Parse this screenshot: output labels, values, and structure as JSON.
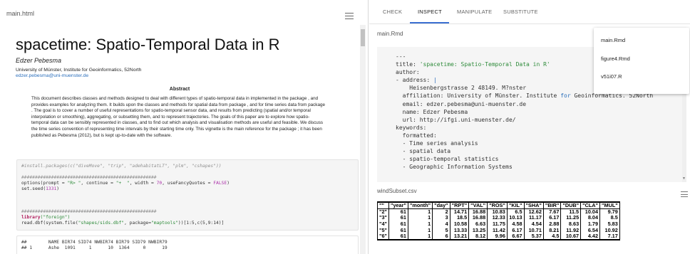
{
  "left": {
    "filename": "main.html",
    "doc": {
      "title": "spacetime: Spatio-Temporal Data in R",
      "author": "Edzer Pebesma",
      "affiliation": "University of Münster, Institute for Geoinformatics, 52North",
      "email": "edzer.pebesma@uni-muenster.de",
      "abstract_heading": "Abstract",
      "abstract_text": "This document describes classes and methods designed to deal with different types of spatio-temporal data in implemented in the package , and provides examples for analyzing them. It builds upon the classes and methods for spatial data from package , and for time series data from package . The goal is to cover a number of useful representations for spatio-temporal sensor data, and results from predicting (spatial and/or temporal interpolation or smoothing), aggregating, or subsetting them, and to represent trajectories. The goals of this paper are to explore how spatio-temporal data can be sensibly represented in classes, and to find out which analysis and visualisation methods are useful and feasible. We discuss the time series convention of representing time intervals by their starting time only. This vignette is the main reference for the package ; it has been published as Pebesma (2012), but is kept up-to-date with the software."
    },
    "code1": {
      "comment1": "#install.packages(c(\"diveMove\", \"trip\", \"adehabitatLT\", \"plm\", \"cshapes\"))",
      "hashes": "##################################################",
      "opt_pre": "options(prompt = ",
      "opt_prompt": "\"R> \"",
      "opt_mid1": ", continue = ",
      "opt_cont": "\"+  \"",
      "opt_mid2": ", width = ",
      "opt_width": "70",
      "opt_mid3": ", useFancyQuotes = ",
      "opt_false": "FALSE",
      "opt_end": ")",
      "seed_pre": "set.seed(",
      "seed_num": "1331",
      "seed_end": ")",
      "lib_kw": "library",
      "lib_arg": "(\"foreign\")",
      "read_pre": "read.dbf(system.file(",
      "read_str1": "\"shapes/sids.dbf\"",
      "read_mid": ", package=",
      "read_str2": "\"maptools\"",
      "read_post": "))[1:5,c(5,9:14)]"
    },
    "code2": {
      "line1": "##        NAME BIR74 SID74 NWBIR74 BIR79 SID79 NWBIR79",
      "line2": "## 1      Ashe  1091     1      10  1364     0      19"
    }
  },
  "right": {
    "tabs": [
      {
        "label": "CHECK"
      },
      {
        "label": "INSPECT"
      },
      {
        "label": "MANIPULATE"
      },
      {
        "label": "SUBSTITUTE"
      }
    ],
    "rmd_filename": "main.Rmd",
    "rmd_lines": {
      "l1": "---",
      "l2_key": "title: ",
      "l2_val": "'spacetime: Spatio-Temporal Data in R'",
      "l3": "author:",
      "l4_key": "- address: ",
      "l4_val": "|",
      "l5": "    Heisenbergstrasse 2 48149. M?nster",
      "l6_pre": "  affiliation: University of Münster. Institute ",
      "l6_for": "for",
      "l6_post": " Geoinformatics. 52North",
      "l7": "  email: edzer.pebesma@uni-muenster.de",
      "l8": "  name: Edzer Pebesma",
      "l9": "  url: http://ifgi.uni-muenster.de/",
      "l10": "keywords:",
      "l11": "  formatted:",
      "l12": "  - Time series analysis",
      "l13": "  - spatial data",
      "l14": "  - spatio-temporal statistics",
      "l15": "  - Geographic Information Systems"
    },
    "dropdown": [
      {
        "label": "main.Rmd"
      },
      {
        "label": "figure4.Rmd"
      },
      {
        "label": "v51i07.R"
      }
    ],
    "csv_filename": "windSubset.csv",
    "csv": {
      "headers": [
        "\"\"",
        "\"year\"",
        "\"month\"",
        "\"day\"",
        "\"RPT\"",
        "\"VAL\"",
        "\"ROS\"",
        "\"KIL\"",
        "\"SHA\"",
        "\"BIR\"",
        "\"DUB\"",
        "\"CLA\"",
        "\"MUL\""
      ],
      "rows": [
        [
          "\"2\"",
          "61",
          "1",
          "2",
          "14.71",
          "16.88",
          "10.83",
          "6.5",
          "12.62",
          "7.67",
          "11.5",
          "10.04",
          "9.79"
        ],
        [
          "\"3\"",
          "61",
          "1",
          "3",
          "18.5",
          "16.88",
          "12.33",
          "10.13",
          "11.17",
          "6.17",
          "11.25",
          "8.04",
          "8.5"
        ],
        [
          "\"4\"",
          "61",
          "1",
          "4",
          "10.58",
          "6.63",
          "11.75",
          "4.58",
          "4.54",
          "2.88",
          "8.63",
          "1.79",
          "5.83"
        ],
        [
          "\"5\"",
          "61",
          "1",
          "5",
          "13.33",
          "13.25",
          "11.42",
          "6.17",
          "10.71",
          "8.21",
          "11.92",
          "6.54",
          "10.92"
        ],
        [
          "\"6\"",
          "61",
          "1",
          "6",
          "13.21",
          "8.12",
          "9.96",
          "6.67",
          "5.37",
          "4.5",
          "10.67",
          "4.42",
          "7.17"
        ]
      ]
    }
  }
}
